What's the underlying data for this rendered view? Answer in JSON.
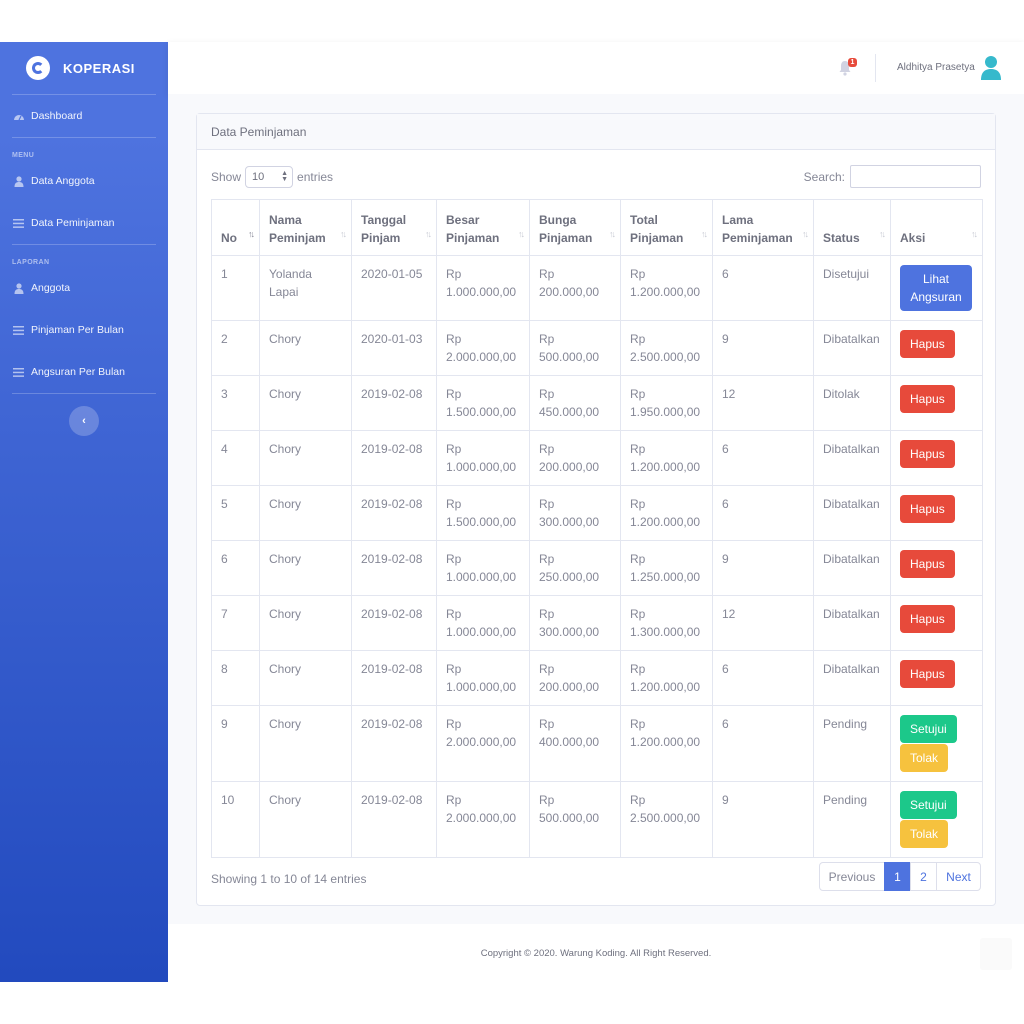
{
  "brand": {
    "name": "KOPERASI"
  },
  "sidebar": {
    "dashboard": "Dashboard",
    "heading_menu": "MENU",
    "menu_items": [
      {
        "label": "Data Anggota",
        "icon": "user-icon"
      },
      {
        "label": "Data Peminjaman",
        "icon": "list-icon"
      }
    ],
    "heading_laporan": "LAPORAN",
    "laporan_items": [
      {
        "label": "Anggota",
        "icon": "user-icon"
      },
      {
        "label": "Pinjaman Per Bulan",
        "icon": "list-icon"
      },
      {
        "label": "Angsuran Per Bulan",
        "icon": "list-icon"
      }
    ],
    "toggle": "‹"
  },
  "topbar": {
    "notification_count": "1",
    "user_name": "Aldhitya Prasetya"
  },
  "card": {
    "title": "Data Peminjaman"
  },
  "controls": {
    "show_label": "Show",
    "entries_value": "10",
    "entries_label": "entries",
    "search_label": "Search:",
    "search_value": ""
  },
  "table": {
    "headers": [
      {
        "l1": "",
        "l2": "No"
      },
      {
        "l1": "Nama",
        "l2": "Peminjam"
      },
      {
        "l1": "Tanggal",
        "l2": "Pinjam"
      },
      {
        "l1": "Besar",
        "l2": "Pinjaman"
      },
      {
        "l1": "Bunga",
        "l2": "Pinjaman"
      },
      {
        "l1": "Total",
        "l2": "Pinjaman"
      },
      {
        "l1": "Lama",
        "l2": "Peminjaman"
      },
      {
        "l1": "",
        "l2": "Status"
      },
      {
        "l1": "",
        "l2": "Aksi"
      }
    ],
    "rows": [
      {
        "no": "1",
        "nama": "Yolanda Lapai",
        "tanggal": "2020-01-05",
        "besar": "Rp 1.000.000,00",
        "bunga": "Rp 200.000,00",
        "total": "Rp 1.200.000,00",
        "lama": "6",
        "status": "Disetujui",
        "actions": [
          "Lihat Angsuran"
        ]
      },
      {
        "no": "2",
        "nama": "Chory",
        "tanggal": "2020-01-03",
        "besar": "Rp 2.000.000,00",
        "bunga": "Rp 500.000,00",
        "total": "Rp 2.500.000,00",
        "lama": "9",
        "status": "Dibatalkan",
        "actions": [
          "Hapus"
        ]
      },
      {
        "no": "3",
        "nama": "Chory",
        "tanggal": "2019-02-08",
        "besar": "Rp 1.500.000,00",
        "bunga": "Rp 450.000,00",
        "total": "Rp 1.950.000,00",
        "lama": "12",
        "status": "Ditolak",
        "actions": [
          "Hapus"
        ]
      },
      {
        "no": "4",
        "nama": "Chory",
        "tanggal": "2019-02-08",
        "besar": "Rp 1.000.000,00",
        "bunga": "Rp 200.000,00",
        "total": "Rp 1.200.000,00",
        "lama": "6",
        "status": "Dibatalkan",
        "actions": [
          "Hapus"
        ]
      },
      {
        "no": "5",
        "nama": "Chory",
        "tanggal": "2019-02-08",
        "besar": "Rp 1.500.000,00",
        "bunga": "Rp 300.000,00",
        "total": "Rp 1.200.000,00",
        "lama": "6",
        "status": "Dibatalkan",
        "actions": [
          "Hapus"
        ]
      },
      {
        "no": "6",
        "nama": "Chory",
        "tanggal": "2019-02-08",
        "besar": "Rp 1.000.000,00",
        "bunga": "Rp 250.000,00",
        "total": "Rp 1.250.000,00",
        "lama": "9",
        "status": "Dibatalkan",
        "actions": [
          "Hapus"
        ]
      },
      {
        "no": "7",
        "nama": "Chory",
        "tanggal": "2019-02-08",
        "besar": "Rp 1.000.000,00",
        "bunga": "Rp 300.000,00",
        "total": "Rp 1.300.000,00",
        "lama": "12",
        "status": "Dibatalkan",
        "actions": [
          "Hapus"
        ]
      },
      {
        "no": "8",
        "nama": "Chory",
        "tanggal": "2019-02-08",
        "besar": "Rp 1.000.000,00",
        "bunga": "Rp 200.000,00",
        "total": "Rp 1.200.000,00",
        "lama": "6",
        "status": "Dibatalkan",
        "actions": [
          "Hapus"
        ]
      },
      {
        "no": "9",
        "nama": "Chory",
        "tanggal": "2019-02-08",
        "besar": "Rp 2.000.000,00",
        "bunga": "Rp 400.000,00",
        "total": "Rp 1.200.000,00",
        "lama": "6",
        "status": "Pending",
        "actions": [
          "Setujui",
          "Tolak"
        ]
      },
      {
        "no": "10",
        "nama": "Chory",
        "tanggal": "2019-02-08",
        "besar": "Rp 2.000.000,00",
        "bunga": "Rp 500.000,00",
        "total": "Rp 2.500.000,00",
        "lama": "9",
        "status": "Pending",
        "actions": [
          "Setujui",
          "Tolak"
        ]
      }
    ]
  },
  "footer_info": "Showing 1 to 10 of 14 entries",
  "pagination": {
    "previous": "Previous",
    "pages": [
      "1",
      "2"
    ],
    "active_page": "1",
    "next": "Next"
  },
  "footer": {
    "copyright": "Copyright © 2020. Warung Koding. All Right Reserved."
  },
  "colors": {
    "primary": "#4e73df",
    "danger": "#e74a3b",
    "success": "#1cc88a",
    "warning": "#f6c23e"
  }
}
